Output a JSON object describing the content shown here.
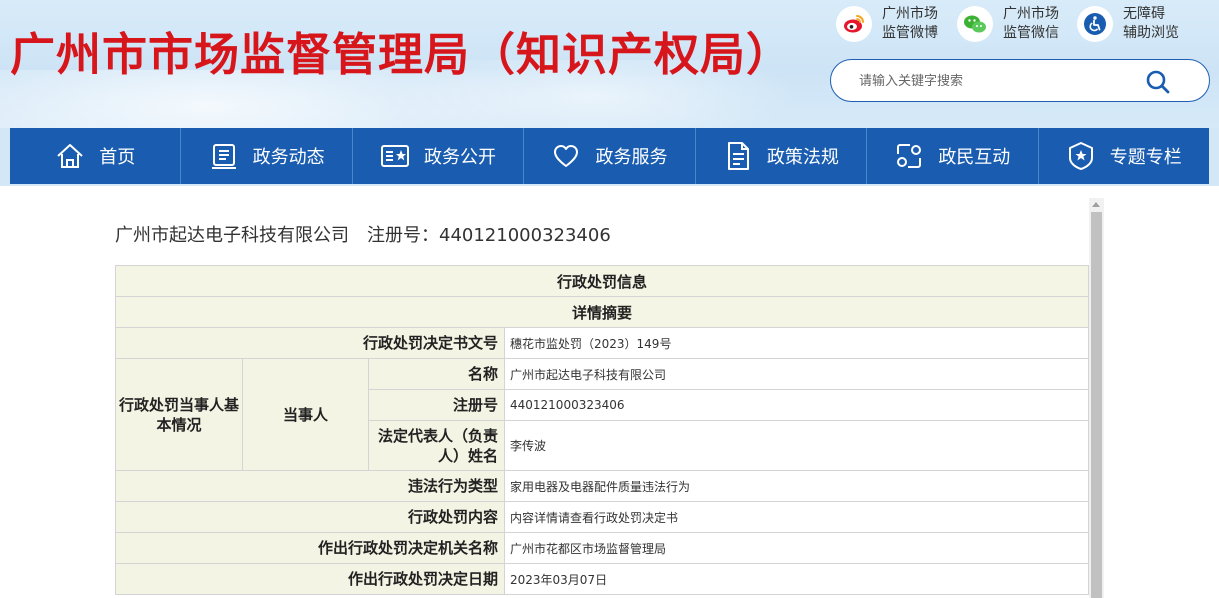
{
  "header": {
    "site_title": "广州市市场监督管理局（知识产权局）",
    "quick_links": [
      {
        "icon": "weibo-icon",
        "line1": "广州市场",
        "line2": "监管微博"
      },
      {
        "icon": "wechat-icon",
        "line1": "广州市场",
        "line2": "监管微信"
      },
      {
        "icon": "accessibility-icon",
        "line1": "无障碍",
        "line2": "辅助浏览"
      }
    ],
    "search": {
      "placeholder": "请输入关键字搜索"
    }
  },
  "nav": {
    "items": [
      {
        "label": "首页",
        "icon": "home-icon"
      },
      {
        "label": "政务动态",
        "icon": "news-icon"
      },
      {
        "label": "政务公开",
        "icon": "open-affairs-icon"
      },
      {
        "label": "政务服务",
        "icon": "heart-icon"
      },
      {
        "label": "政策法规",
        "icon": "document-icon"
      },
      {
        "label": "政民互动",
        "icon": "interaction-icon"
      },
      {
        "label": "专题专栏",
        "icon": "badge-icon"
      }
    ]
  },
  "content": {
    "company_name": "广州市起达电子科技有限公司",
    "registration_text": "注册号：440121000323406",
    "table": {
      "title": "行政处罚信息",
      "subtitle": "详情摘要",
      "decision_no": {
        "label": "行政处罚决定书文号",
        "value": "穗花市监处罚（2023）149号"
      },
      "party_group_label": "行政处罚当事人基本情况",
      "party_label": "当事人",
      "name": {
        "label": "名称",
        "value": "广州市起达电子科技有限公司"
      },
      "reg_no": {
        "label": "注册号",
        "value": "440121000323406"
      },
      "legal_rep": {
        "label": "法定代表人（负责人）姓名",
        "value": "李传波"
      },
      "violation_type": {
        "label": "违法行为类型",
        "value": "家用电器及电器配件质量违法行为"
      },
      "penalty_content": {
        "label": "行政处罚内容",
        "value": "内容详情请查看行政处罚决定书"
      },
      "authority": {
        "label": "作出行政处罚决定机关名称",
        "value": "广州市花都区市场监督管理局"
      },
      "decision_date": {
        "label": "作出行政处罚决定日期",
        "value": "2023年03月07日"
      }
    }
  },
  "colors": {
    "title_red": "#d7161c",
    "nav_blue": "#1a5db0",
    "table_label_bg": "#f4f4e4",
    "table_border": "#d4d4d4"
  }
}
